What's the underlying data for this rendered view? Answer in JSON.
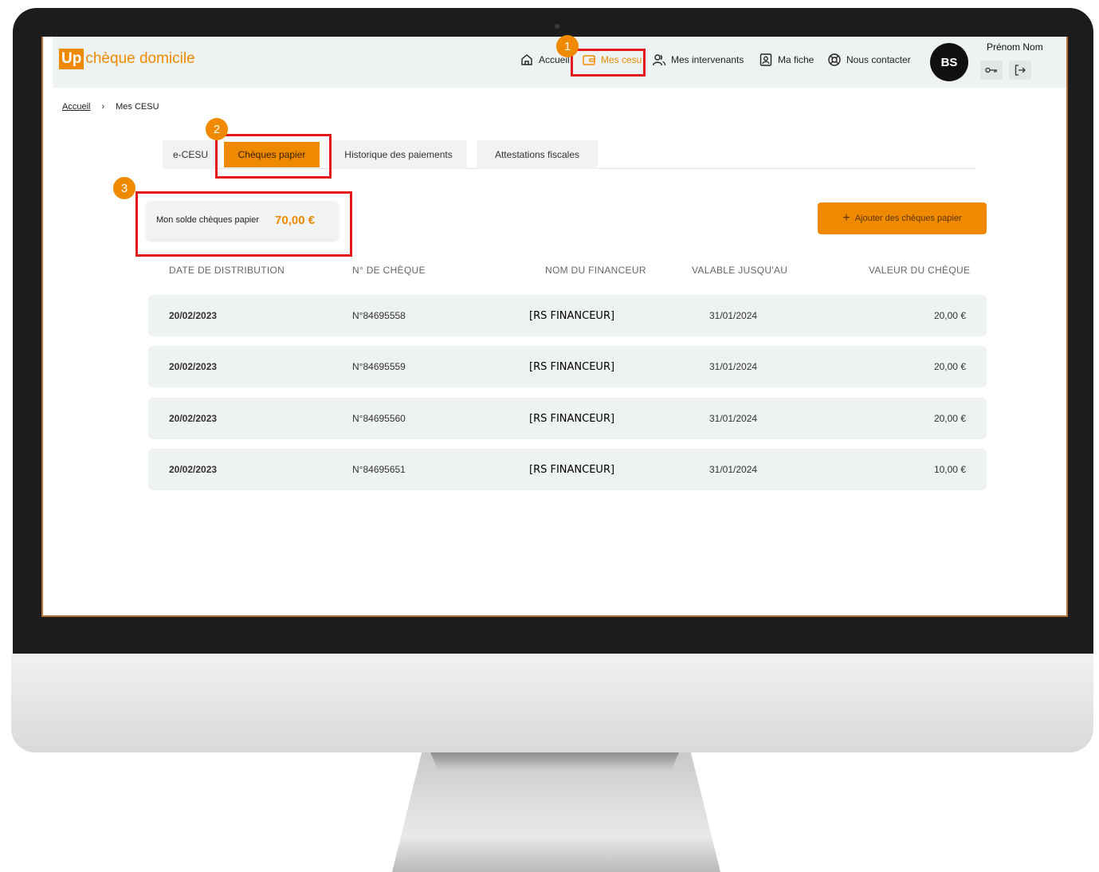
{
  "app": {
    "logo_mark": "Up",
    "logo_text": "chèque domicile"
  },
  "nav": {
    "home": "Accueil",
    "cesu": "Mes cesu",
    "intervenants": "Mes intervenants",
    "fiche": "Ma fiche",
    "contact": "Nous contacter"
  },
  "user": {
    "initials": "BS",
    "name": "Prénom Nom"
  },
  "breadcrumb": {
    "home": "Accueil",
    "separator": "›",
    "current": "Mes CESU"
  },
  "tabs": [
    {
      "label": "e-CESU",
      "active": false
    },
    {
      "label": "Chèques papier",
      "active": true
    },
    {
      "label": "Historique des paiements",
      "active": false
    },
    {
      "label": "Attestations fiscales",
      "active": false
    }
  ],
  "balance": {
    "label": "Mon solde chèques papier",
    "value": "70,00 €"
  },
  "add_button": {
    "icon": "+",
    "label": "Ajouter des chèques papier"
  },
  "table": {
    "headers": [
      "DATE DE DISTRIBUTION",
      "N° DE CHÈQUE",
      "NOM DU FINANCEUR",
      "VALABLE JUSQU'AU",
      "VALEUR DU CHÈQUE"
    ],
    "rows": [
      {
        "date": "20/02/2023",
        "numero": "N°84695558",
        "financeur": "[RS FINANCEUR]",
        "valable": "31/01/2024",
        "valeur": "20,00 €"
      },
      {
        "date": "20/02/2023",
        "numero": "N°84695559",
        "financeur": "[RS FINANCEUR]",
        "valable": "31/01/2024",
        "valeur": "20,00 €"
      },
      {
        "date": "20/02/2023",
        "numero": "N°84695560",
        "financeur": "[RS FINANCEUR]",
        "valable": "31/01/2024",
        "valeur": "20,00 €"
      },
      {
        "date": "20/02/2023",
        "numero": "N°84695651",
        "financeur": "[RS FINANCEUR]",
        "valable": "31/01/2024",
        "valeur": "10,00 €"
      }
    ]
  },
  "annotations": {
    "badge_1": "1",
    "badge_2": "2",
    "badge_3": "3"
  },
  "colors": {
    "accent": "#ef8a00",
    "callout": "#e3161b",
    "row_background": "#eff2f2"
  }
}
